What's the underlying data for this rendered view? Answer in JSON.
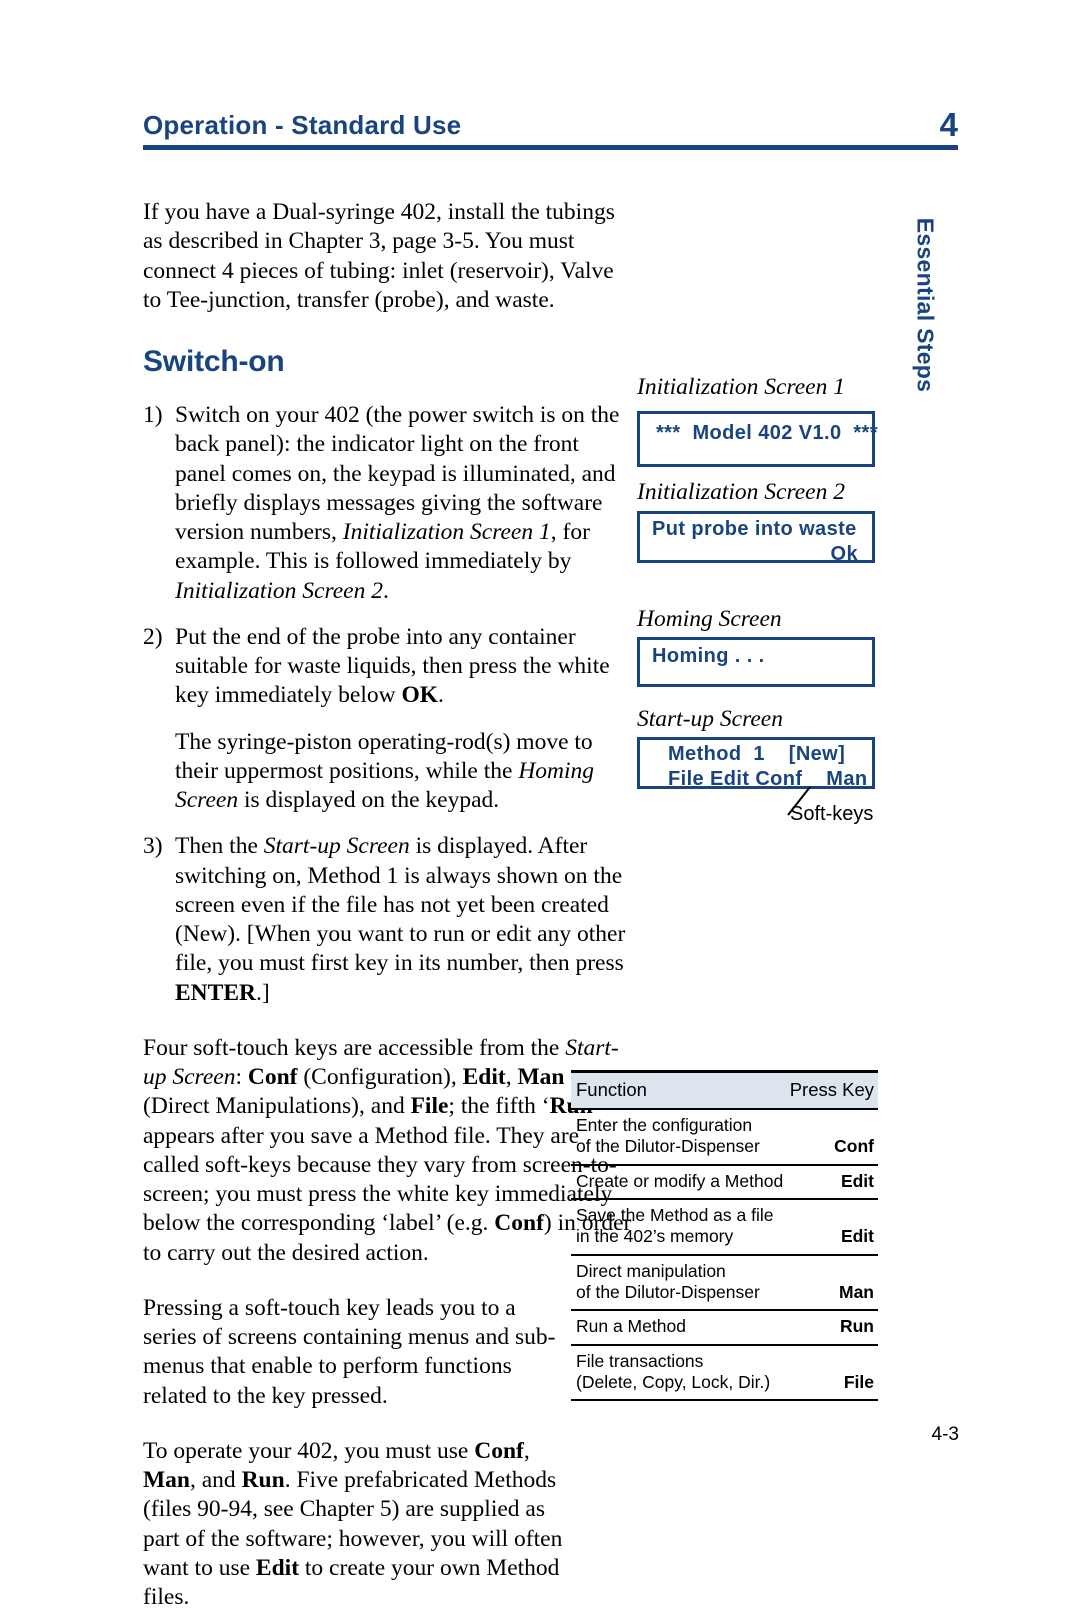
{
  "header": {
    "title": "Operation - Standard Use",
    "chapter_number": "4"
  },
  "side_tab": {
    "label": "Essential Steps"
  },
  "intro": {
    "paragraph": "If you have a Dual-syringe 402, install the tubings as described in Chapter 3, page 3-5. You must connect 4 pieces of tubing: inlet (reservoir), Valve to Tee-junction, transfer (probe), and waste."
  },
  "section": {
    "heading": "Switch-on"
  },
  "steps": [
    {
      "number": "1)",
      "text_a": "Switch on your 402 (the power switch is on the back panel): the indicator light on the front panel comes on, the keypad is illuminated, and briefly displays messages giving the software version numbers, ",
      "italic_a": "Initialization Screen 1",
      "text_b": ", for example. This is followed immediately by ",
      "italic_b": "Initialization Screen 2",
      "text_c": "."
    },
    {
      "number": "2)",
      "text_a": "Put the end of the probe into any container suitable for waste liquids, then press the white key immediately below ",
      "bold_a": "OK",
      "text_b": "."
    },
    {
      "number": "3)",
      "text_a": "Then the ",
      "italic_a": "Start-up Screen",
      "text_b": " is displayed. After switching on, Method 1 is always shown on the screen even if the file has not yet been created (New). [When you want to run or edit any other file, you must first key in its number, then press ",
      "bold_b": "ENTER",
      "text_c": ".]"
    }
  ],
  "step2_followup": {
    "text_a": "The syringe-piston operating-rod(s) move to their uppermost positions, while the ",
    "italic_a": "Homing Screen",
    "text_b": " is displayed on the keypad."
  },
  "softkeys_para": {
    "text_a": "Four soft-touch keys are accessible from the ",
    "italic_a": "Start-up Screen",
    "text_b": ": ",
    "bold_b": "Conf",
    "text_c": " (Configuration), ",
    "bold_c": "Edit",
    "text_d": ", ",
    "bold_d": "Man",
    "text_e": " (Direct Manipulations), and ",
    "bold_e": "File",
    "text_f": "; the fifth ‘",
    "bold_f": "Run",
    "text_g": "’ appears after you save a Method file. They are called soft-keys because they vary from screen-to-screen; you must press the white key immediately below the corresponding ‘label’ (e.g. ",
    "bold_g": "Conf",
    "text_h": ") in order to carry out the desired action."
  },
  "pressing_para": {
    "text": "Pressing a soft-touch key leads you to a series of screens containing menus and sub-menus that enable to perform functions related to the key pressed."
  },
  "operate_para": {
    "text_a": "To operate your 402, you must use ",
    "bold_a": "Conf",
    "text_b": ", ",
    "bold_b": "Man",
    "text_c": ", and ",
    "bold_c": "Run",
    "text_d": ". Five prefabricated Methods (files 90-94, see Chapter 5) are supplied as part of the software; however, you will often want to use ",
    "bold_d": "Edit",
    "text_e": " to create your own Method files."
  },
  "figures": [
    {
      "caption": "Initialization Screen 1",
      "lines": [
        "***  Model 402 V1.0  ***"
      ]
    },
    {
      "caption": "Initialization Screen 2",
      "lines": [
        "Put probe into waste",
        "Ok"
      ]
    },
    {
      "caption": "Homing Screen",
      "lines": [
        "Homing . . ."
      ]
    },
    {
      "caption": "Start-up Screen",
      "lines": [
        "Method  1    [New]",
        "File Edit Conf    Man"
      ]
    }
  ],
  "callout": {
    "softkeys_label": "Soft-keys"
  },
  "table": {
    "headers": {
      "function": "Function",
      "key": "Press Key"
    },
    "rows": [
      {
        "lines": [
          "Enter the configuration",
          "of the Dilutor-Dispenser"
        ],
        "key": "Conf"
      },
      {
        "lines": [
          "Create or modify a Method"
        ],
        "key": "Edit"
      },
      {
        "lines": [
          "Save the Method as a file",
          "in the 402’s memory"
        ],
        "key": "Edit"
      },
      {
        "lines": [
          "Direct manipulation",
          "of the Dilutor-Dispenser"
        ],
        "key": "Man"
      },
      {
        "lines": [
          "Run a Method"
        ],
        "key": "Run"
      },
      {
        "lines": [
          "File transactions",
          "(Delete, Copy, Lock, Dir.)"
        ],
        "key": "File"
      }
    ]
  },
  "footer": {
    "page_number": "4-3"
  },
  "colors": {
    "accent_blue": "#1a4480",
    "table_header_bg": "#dce5ee"
  }
}
